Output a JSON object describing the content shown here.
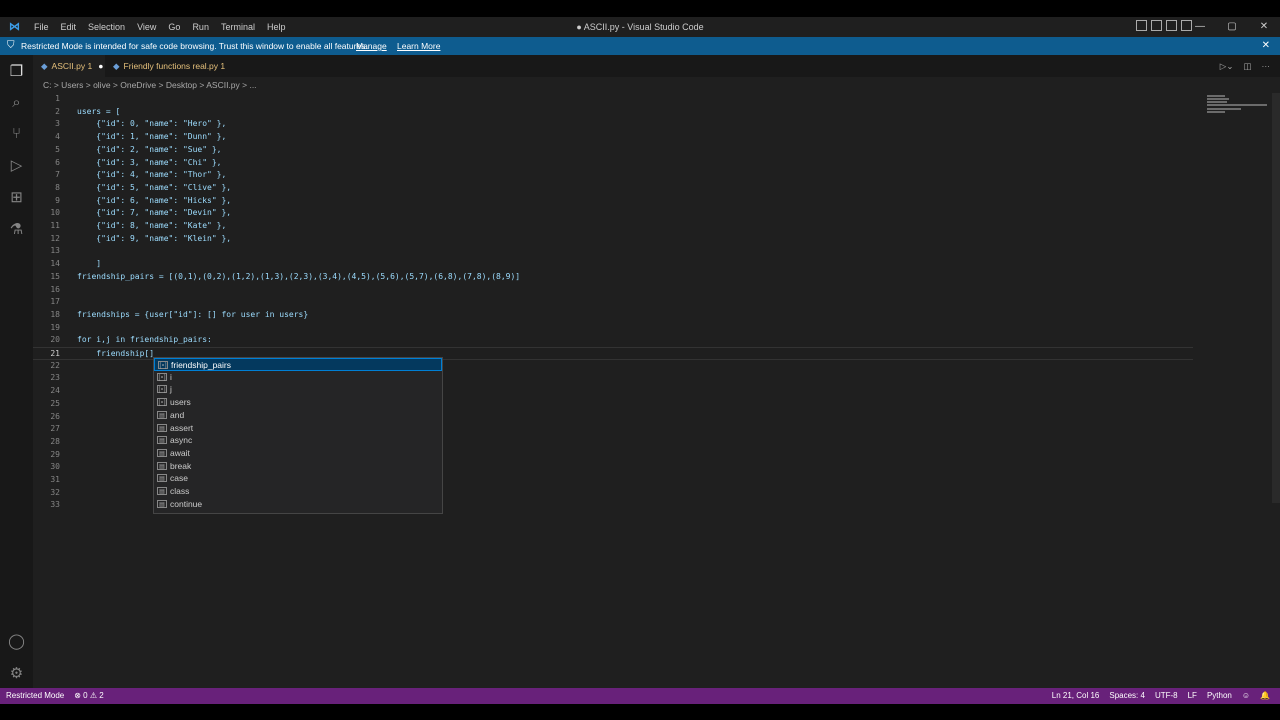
{
  "titlebar": {
    "menu": [
      "File",
      "Edit",
      "Selection",
      "View",
      "Go",
      "Run",
      "Terminal",
      "Help"
    ],
    "window_title": "● ASCII.py - Visual Studio Code",
    "controls": [
      "—",
      "▢",
      "✕"
    ]
  },
  "banner": {
    "message": "Restricted Mode is intended for safe code browsing. Trust this window to enable all features.",
    "manage": "Manage",
    "learn_more": "Learn More",
    "close": "✕"
  },
  "tabs": [
    {
      "label": "ASCII.py",
      "badge": "1",
      "dirty": "●"
    },
    {
      "label": "Friendly functions real.py",
      "badge": "1"
    }
  ],
  "breadcrumb": "C: > Users > olive > OneDrive > Desktop > ASCII.py > ...",
  "code_lines": [
    {
      "n": "1",
      "text": ""
    },
    {
      "n": "2",
      "text": "users = ["
    },
    {
      "n": "3",
      "text": "    {\"id\": 0, \"name\": \"Hero\" },"
    },
    {
      "n": "4",
      "text": "    {\"id\": 1, \"name\": \"Dunn\" },"
    },
    {
      "n": "5",
      "text": "    {\"id\": 2, \"name\": \"Sue\" },"
    },
    {
      "n": "6",
      "text": "    {\"id\": 3, \"name\": \"Chi\" },"
    },
    {
      "n": "7",
      "text": "    {\"id\": 4, \"name\": \"Thor\" },"
    },
    {
      "n": "8",
      "text": "    {\"id\": 5, \"name\": \"Clive\" },"
    },
    {
      "n": "9",
      "text": "    {\"id\": 6, \"name\": \"Hicks\" },"
    },
    {
      "n": "10",
      "text": "    {\"id\": 7, \"name\": \"Devin\" },"
    },
    {
      "n": "11",
      "text": "    {\"id\": 8, \"name\": \"Kate\" },"
    },
    {
      "n": "12",
      "text": "    {\"id\": 9, \"name\": \"Klein\" },"
    },
    {
      "n": "13",
      "text": ""
    },
    {
      "n": "14",
      "text": "    ]"
    },
    {
      "n": "15",
      "text": "friendship_pairs = [(0,1),(0,2),(1,2),(1,3),(2,3),(3,4),(4,5),(5,6),(5,7),(6,8),(7,8),(8,9)]"
    },
    {
      "n": "16",
      "text": ""
    },
    {
      "n": "17",
      "text": ""
    },
    {
      "n": "18",
      "text": "friendships = {user[\"id\"]: [] for user in users}"
    },
    {
      "n": "19",
      "text": ""
    },
    {
      "n": "20",
      "text": "for i,j in friendship_pairs:"
    },
    {
      "n": "21",
      "text": "    friendship[]"
    },
    {
      "n": "22",
      "text": ""
    },
    {
      "n": "23",
      "text": ""
    },
    {
      "n": "24",
      "text": ""
    },
    {
      "n": "25",
      "text": ""
    },
    {
      "n": "26",
      "text": ""
    },
    {
      "n": "27",
      "text": ""
    },
    {
      "n": "28",
      "text": ""
    },
    {
      "n": "29",
      "text": ""
    },
    {
      "n": "30",
      "text": ""
    },
    {
      "n": "31",
      "text": ""
    },
    {
      "n": "32",
      "text": ""
    },
    {
      "n": "33",
      "text": ""
    }
  ],
  "suggestions": [
    {
      "label": "friendship_pairs",
      "kind": "variable"
    },
    {
      "label": "i",
      "kind": "variable"
    },
    {
      "label": "j",
      "kind": "variable"
    },
    {
      "label": "users",
      "kind": "variable"
    },
    {
      "label": "and",
      "kind": "keyword"
    },
    {
      "label": "assert",
      "kind": "keyword"
    },
    {
      "label": "async",
      "kind": "keyword"
    },
    {
      "label": "await",
      "kind": "keyword"
    },
    {
      "label": "break",
      "kind": "keyword"
    },
    {
      "label": "case",
      "kind": "keyword"
    },
    {
      "label": "class",
      "kind": "keyword"
    },
    {
      "label": "continue",
      "kind": "keyword"
    }
  ],
  "status": {
    "mode": "Restricted Mode",
    "errors": "⊗ 0 ⚠ 2",
    "position": "Ln 21, Col 16",
    "spaces": "Spaces: 4",
    "encoding": "UTF-8",
    "eol": "LF",
    "language": "Python"
  },
  "colors": {
    "banner": "#0e5c8f",
    "status_bar": "#68217a",
    "editor_bg": "#1f1f1f",
    "selected_suggestion": "#04395e"
  }
}
